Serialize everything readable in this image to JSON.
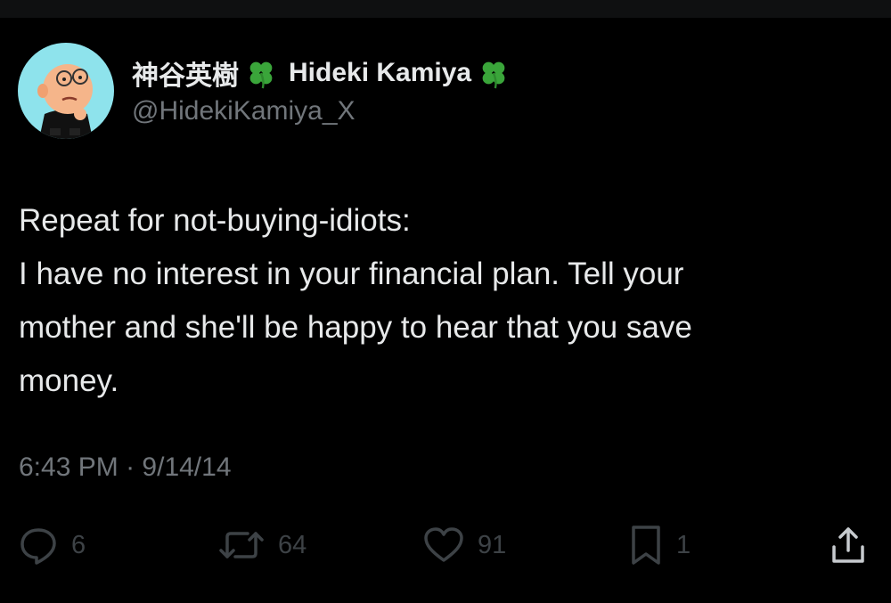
{
  "author": {
    "name_jp": "神谷英樹",
    "name_en": "Hideki Kamiya",
    "handle": "@HidekiKamiya_X"
  },
  "post": {
    "lines": [
      "Repeat for not-buying-idiots:",
      "I have no interest in your financial plan. Tell your",
      "mother and she'll be happy to hear that you save",
      "money."
    ],
    "time": "6:43 PM",
    "separator": "·",
    "date": "9/14/14"
  },
  "actions": {
    "replies": "6",
    "reposts": "64",
    "likes": "91",
    "bookmarks": "1"
  },
  "icons": {
    "avatar": "cartoon-avatar-icon",
    "clover": "four-leaf-clover-icon",
    "reply": "reply-icon",
    "repost": "repost-icon",
    "like": "heart-icon",
    "bookmark": "bookmark-icon",
    "share": "share-icon"
  },
  "colors": {
    "background": "#000000",
    "text": "#e7e9ea",
    "muted": "#71767b",
    "action": "#3d4246",
    "avatar_bg": "#8ee3ec",
    "clover": "#3aa53a"
  }
}
